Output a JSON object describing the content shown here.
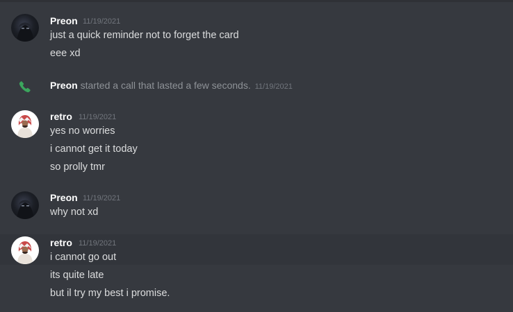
{
  "messages": [
    {
      "author": "Preon",
      "timestamp": "11/19/2021",
      "avatar": "preon-avatar",
      "lines": [
        "just a quick reminder not to forget the card",
        "eee xd"
      ]
    },
    {
      "author": "retro",
      "timestamp": "11/19/2021",
      "avatar": "retro-avatar",
      "lines": [
        "yes no worries",
        "i cannot get it today",
        "so prolly tmr"
      ]
    },
    {
      "author": "Preon",
      "timestamp": "11/19/2021",
      "avatar": "preon-avatar",
      "lines": [
        "why not xd"
      ]
    },
    {
      "author": "retro",
      "timestamp": "11/19/2021",
      "avatar": "retro-avatar",
      "lines": [
        "i cannot go out",
        "its quite late",
        "but il try my best i promise."
      ]
    }
  ],
  "call_event": {
    "caller": "Preon",
    "text": "started a call that lasted a few seconds.",
    "timestamp": "11/19/2021",
    "icon": "phone-icon",
    "icon_color": "#3ba55d"
  },
  "colors": {
    "background": "#36393f",
    "username": "#ffffff",
    "message_text": "#dcddde",
    "timestamp": "#72767d",
    "hover_background": "#32353b"
  }
}
